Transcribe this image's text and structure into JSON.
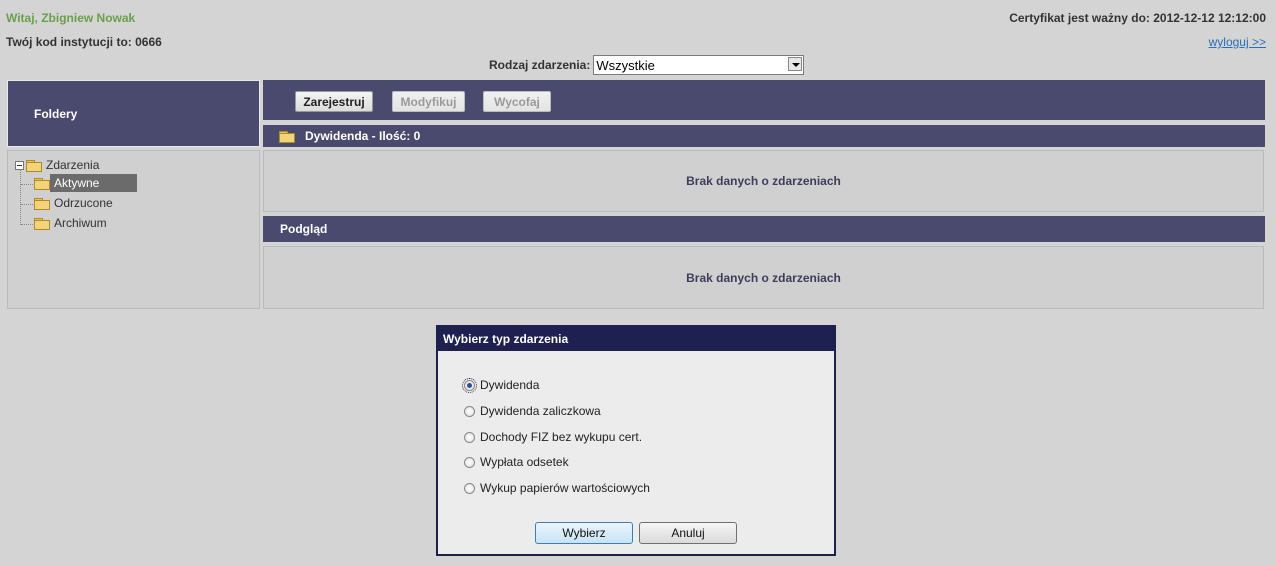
{
  "header": {
    "greeting": "Witaj, Zbigniew Nowak",
    "institution_label": "Twój kod instytucji to:",
    "institution_code": "0666",
    "certificate_label": "Certyfikat jest ważny do: 2012-12-12 12:12:00",
    "logout_link": "wyloguj >>"
  },
  "filter": {
    "label": "Rodzaj zdarzenia:",
    "selected": "Wszystkie"
  },
  "folders": {
    "title": "Foldery",
    "tree": {
      "root": "Zdarzenia",
      "children": [
        "Aktywne",
        "Odrzucone",
        "Archiwum"
      ],
      "selected": "Aktywne"
    }
  },
  "toolbar": {
    "register": "Zarejestruj",
    "modify": "Modyfikuj",
    "withdraw": "Wycofaj"
  },
  "list": {
    "header": "Dywidenda - Ilość: 0",
    "empty_message": "Brak danych o zdarzeniach"
  },
  "preview": {
    "header": "Podgląd",
    "empty_message": "Brak danych o zdarzeniach"
  },
  "dialog": {
    "title": "Wybierz typ zdarzenia",
    "options": [
      "Dywidenda",
      "Dywidenda zaliczkowa",
      "Dochody FIZ bez wykupu cert.",
      "Wypłata odsetek",
      "Wykup papierów wartościowych"
    ],
    "selected": "Dywidenda",
    "ok": "Wybierz",
    "cancel": "Anuluj"
  },
  "colors": {
    "panel_header": "#4a4a6e",
    "dialog_header": "#1e2050",
    "greeting": "#6aa04a",
    "link": "#2a6fb5"
  }
}
